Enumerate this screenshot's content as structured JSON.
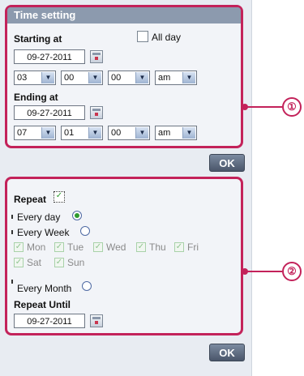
{
  "time_setting": {
    "title": "Time setting",
    "all_day_label": "All day",
    "starting_label": "Starting at",
    "start_date": "09-27-2011",
    "start_hour": "03",
    "start_minute": "00",
    "start_second": "00",
    "start_ampm": "am",
    "ending_label": "Ending at",
    "end_date": "09-27-2011",
    "end_hour": "07",
    "end_minute": "01",
    "end_second": "00",
    "end_ampm": "am",
    "ok_label": "OK"
  },
  "repeat": {
    "repeat_label": "Repeat",
    "every_day_label": "Every day",
    "every_week_label": "Every Week",
    "days": [
      "Mon",
      "Tue",
      "Wed",
      "Thu",
      "Fri",
      "Sat",
      "Sun"
    ],
    "every_month_label": "Every Month",
    "repeat_until_label": "Repeat Until",
    "until_date": "09-27-2011",
    "ok_label": "OK"
  },
  "callouts": {
    "one": "①",
    "two": "②"
  }
}
